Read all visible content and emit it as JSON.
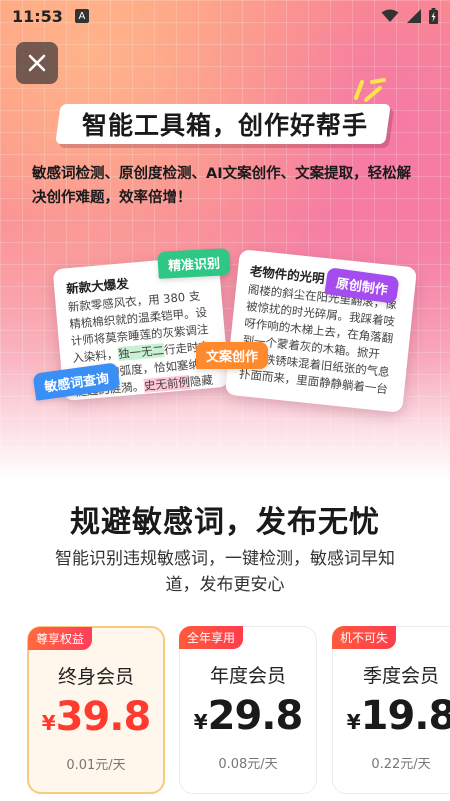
{
  "status_bar": {
    "time": "11:53",
    "indicator": "A"
  },
  "colors": {
    "accent_red": "#ff3b30",
    "badge_red": "#ff3d5c",
    "selected_border": "#f9c982"
  },
  "hero": {
    "headline": "智能工具箱，创作好帮手",
    "description": "敏感词检测、原创度检测、AI文案创作、文案提取，轻松解决创作难题，效率倍增！",
    "card_left": {
      "title": "新款大爆发",
      "text_a": "新款零感风衣，用 380 支精梳棉织就的温柔铠甲。设计师将莫奈睡莲的灰紫调注入染料，",
      "text_mark_1": "独一无二",
      "text_b": "行走时衣摆扬起的弧度，恰如塞纳河泛起的涟漪。",
      "text_mark_2": "史无前例",
      "text_c": "隐藏式口袋能装下雨伞与口红，连纽扣都是手工打磨的铜扣，每一处都在细节里留住温柔。"
    },
    "card_right": {
      "title": "老物件的光明",
      "text": "阁楼的斜尘在阳光里翻滚，像被惊扰的时光碎屑。我踩着吱呀作响的木梯上去，在角落翻到一个蒙着灰的木箱。掀开时，铁锈味混着旧纸张的气息扑面而来，里面静静躺着一台旧铜座钟，那是岁月的老物件，钟面玻璃上的鎏金已经斑驳，指针停在三点十分。"
    },
    "tags": {
      "precise": "精准识别",
      "original": "原创制作",
      "sensitive": "敏感词查询",
      "copy": "文案创作"
    }
  },
  "section": {
    "title": "规避敏感词，发布无忧",
    "subtitle": "智能识别违规敏感词，一键检测，敏感词早知道，发布更安心"
  },
  "plans": [
    {
      "badge": "尊享权益",
      "name": "终身会员",
      "currency": "¥",
      "price": "39.8",
      "daily": "0.01元/天",
      "selected": true
    },
    {
      "badge": "全年享用",
      "name": "年度会员",
      "currency": "¥",
      "price": "29.8",
      "daily": "0.08元/天",
      "selected": false
    },
    {
      "badge": "机不可失",
      "name": "季度会员",
      "currency": "¥",
      "price": "19.8",
      "daily": "0.22元/天",
      "selected": false
    }
  ],
  "icons": [
    "close-icon",
    "wifi-icon",
    "signal-icon",
    "battery-icon"
  ]
}
